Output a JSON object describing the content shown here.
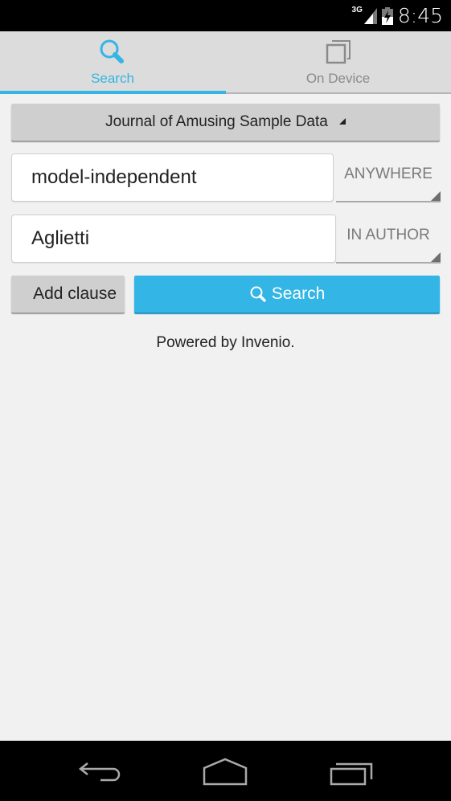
{
  "status_bar": {
    "network_type": "3G",
    "time": "8:45",
    "icons": [
      "signal-icon",
      "battery-charging-icon"
    ]
  },
  "tabs": [
    {
      "label": "Search",
      "icon": "search-icon",
      "selected": true
    },
    {
      "label": "On Device",
      "icon": "copy-icon",
      "selected": false
    }
  ],
  "collection_selector": {
    "label": "Journal of Amusing Sample Data"
  },
  "clauses": [
    {
      "value": "model-independent",
      "scope": "ANYWHERE"
    },
    {
      "value": "Aglietti",
      "scope": "IN AUTHOR"
    }
  ],
  "actions": {
    "add_clause_label": "Add clause",
    "search_label": "Search"
  },
  "footer_text": "Powered by Invenio.",
  "colors": {
    "accent": "#33b5e5",
    "button_gray": "#cfcfcf",
    "background": "#f1f1f1"
  },
  "nav_bar": {
    "buttons": [
      "back",
      "home",
      "recent-apps"
    ]
  }
}
